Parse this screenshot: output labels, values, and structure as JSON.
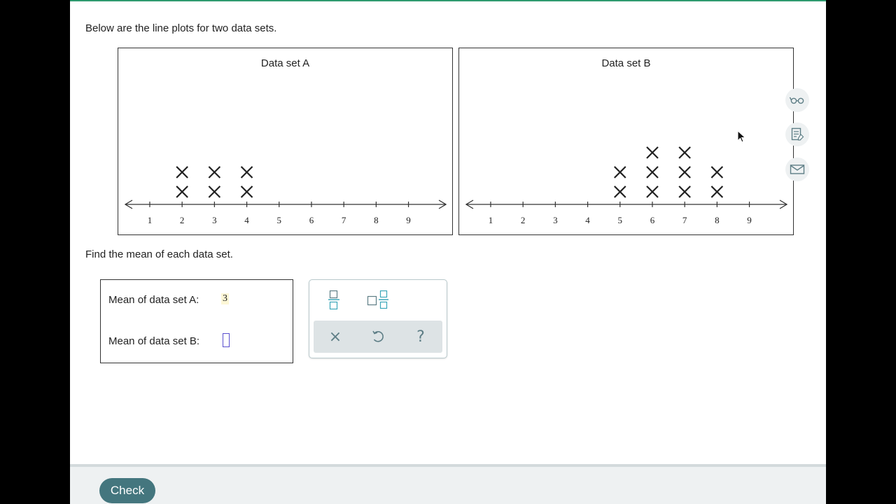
{
  "instructions": {
    "intro": "Below are the line plots for two data sets.",
    "find_mean": "Find the mean of each data set."
  },
  "chart_data": [
    {
      "type": "scatter",
      "title": "Data set A",
      "x_ticks": [
        1,
        2,
        3,
        4,
        5,
        6,
        7,
        8,
        9
      ],
      "xlim": [
        0.2,
        10.2
      ],
      "points": [
        {
          "value": 2,
          "count": 2
        },
        {
          "value": 3,
          "count": 2
        },
        {
          "value": 4,
          "count": 2
        }
      ]
    },
    {
      "type": "scatter",
      "title": "Data set B",
      "x_ticks": [
        1,
        2,
        3,
        4,
        5,
        6,
        7,
        8,
        9
      ],
      "xlim": [
        0.2,
        10.2
      ],
      "points": [
        {
          "value": 5,
          "count": 2
        },
        {
          "value": 6,
          "count": 3
        },
        {
          "value": 7,
          "count": 3
        },
        {
          "value": 8,
          "count": 2
        }
      ]
    }
  ],
  "answers": {
    "mean_a_label": "Mean of data set A:",
    "mean_a_value": "3",
    "mean_b_label": "Mean of data set B:",
    "mean_b_value": ""
  },
  "keypad": {
    "icons": [
      "fraction-icon",
      "mixed-number-icon",
      "clear-icon",
      "undo-icon",
      "help-icon"
    ],
    "clear_symbol": "×",
    "help_symbol": "?"
  },
  "side_tools": [
    "glasses-icon",
    "notes-icon",
    "mail-icon"
  ],
  "footer": {
    "check_label": "Check"
  },
  "colors": {
    "check_button": "#44767e",
    "keypad_icon": "#5e7e86",
    "keypad_accent": "#3aa6b9",
    "input_border": "#5a4fcf",
    "top_accent": "#2e9b6f"
  }
}
